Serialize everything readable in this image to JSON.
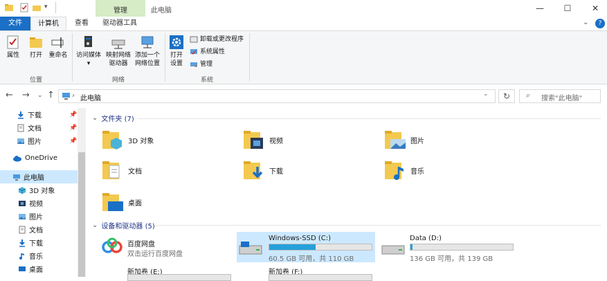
{
  "window": {
    "title": "此电脑",
    "contextual_tab": "管理",
    "controls": {
      "minimize": "—",
      "maximize": "☐",
      "close": "✕"
    }
  },
  "tabs": [
    "文件",
    "计算机",
    "查看",
    "驱动器工具"
  ],
  "ribbon": {
    "location_group": {
      "label": "位置",
      "buttons": [
        "属性",
        "打开",
        "重命名"
      ]
    },
    "network_group": {
      "label": "网络",
      "buttons": [
        {
          "line1": "访问媒体",
          "line2": ""
        },
        {
          "line1": "映射网络",
          "line2": "驱动器"
        },
        {
          "line1": "添加一个",
          "line2": "网络位置"
        }
      ]
    },
    "system_group": {
      "label": "系统",
      "open_settings": {
        "line1": "打开",
        "line2": "设置"
      },
      "items": [
        "卸载或更改程序",
        "系统属性",
        "管理"
      ]
    }
  },
  "address": {
    "path": "此电脑",
    "search_placeholder": "搜索\"此电脑\""
  },
  "sidebar": {
    "quick_access": [
      {
        "label": "下载",
        "icon": "download-icon",
        "pinned": true
      },
      {
        "label": "文档",
        "icon": "document-icon",
        "pinned": true
      },
      {
        "label": "图片",
        "icon": "picture-icon",
        "pinned": true
      }
    ],
    "onedrive": "OneDrive",
    "this_pc": "此电脑",
    "pc_items": [
      {
        "label": "3D 对象",
        "icon": "3d-objects-icon"
      },
      {
        "label": "视频",
        "icon": "video-icon"
      },
      {
        "label": "图片",
        "icon": "picture-icon"
      },
      {
        "label": "文档",
        "icon": "document-icon"
      },
      {
        "label": "下载",
        "icon": "download-icon"
      },
      {
        "label": "音乐",
        "icon": "music-icon"
      },
      {
        "label": "桌面",
        "icon": "desktop-icon"
      }
    ]
  },
  "folders_section": {
    "title": "文件夹 (7)",
    "items": [
      "3D 对象",
      "视频",
      "图片",
      "文档",
      "下载",
      "音乐",
      "桌面"
    ]
  },
  "devices_section": {
    "title": "设备和驱动器 (5)",
    "items": [
      {
        "name": "百度网盘",
        "sub": "双击运行百度网盘"
      },
      {
        "name": "Windows-SSD (C:)",
        "sub": "60.5 GB 可用，共 110 GB",
        "used_fraction": 0.45
      },
      {
        "name": "Data (D:)",
        "sub": "136 GB 可用，共 139 GB",
        "used_fraction": 0.02
      },
      {
        "name": "新加卷 (E:)",
        "sub": ""
      },
      {
        "name": "新加卷 (F:)",
        "sub": ""
      }
    ]
  },
  "colors": {
    "accent": "#1a6fc6",
    "selection": "#cce8ff",
    "drive_bar": "#26a0da",
    "folder": "#f3c94f",
    "context_tab": "#d6ecc6"
  }
}
